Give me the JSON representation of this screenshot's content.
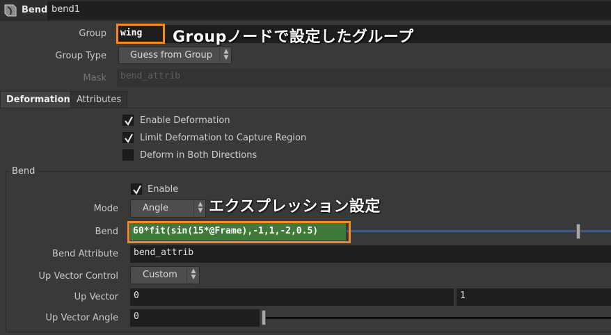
{
  "node": {
    "type": "Bend",
    "name": "bend1"
  },
  "group": {
    "label": "Group",
    "value": "wing"
  },
  "group_type": {
    "label": "Group Type",
    "value": "Guess from Group"
  },
  "mask": {
    "label": "Mask",
    "placeholder": "bend_attrib"
  },
  "tabs": [
    {
      "label": "Deformation",
      "active": true
    },
    {
      "label": "Attributes",
      "active": false
    }
  ],
  "deformation": {
    "enable": {
      "label": "Enable Deformation",
      "checked": true
    },
    "limit": {
      "label": "Limit Deformation to Capture Region",
      "checked": true
    },
    "both": {
      "label": "Deform in Both Directions",
      "checked": false
    }
  },
  "bend_section": {
    "title": "Bend",
    "enable": {
      "label": "Enable",
      "checked": true
    },
    "mode": {
      "label": "Mode",
      "value": "Angle"
    },
    "bend": {
      "label": "Bend",
      "value": "60*fit(sin(15*@Frame),-1,1,-2,0.5)"
    },
    "bend_attribute": {
      "label": "Bend Attribute",
      "value": "bend_attrib"
    },
    "up_vector_control": {
      "label": "Up Vector Control",
      "value": "Custom"
    },
    "up_vector": {
      "label": "Up Vector",
      "x": "0",
      "y": "1"
    },
    "up_vector_angle": {
      "label": "Up Vector Angle",
      "value": "0"
    }
  },
  "annotations": {
    "group_note": "Groupノードで設定したグループ",
    "expression_note": "エクスプレッション設定"
  },
  "colors": {
    "accent_orange": "#f58a1f",
    "expression_green": "#3f7a3a",
    "slider_fill_blue": "#2f5fa0"
  }
}
